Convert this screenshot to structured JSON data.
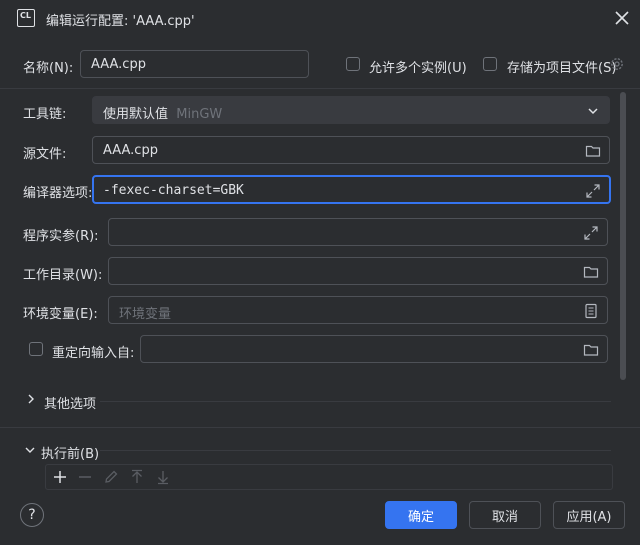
{
  "window": {
    "title": "编辑运行配置: 'AAA.cpp'",
    "app_icon_text": "CL"
  },
  "name": {
    "label": "名称(N):",
    "value": "AAA.cpp"
  },
  "options": {
    "allow_multiple": "允许多个实例(U)",
    "store_as_project": "存储为项目文件(S)"
  },
  "toolchain": {
    "label": "工具链:",
    "value": "使用默认值",
    "hint": "MinGW"
  },
  "source_file": {
    "label": "源文件:",
    "value": "AAA.cpp"
  },
  "compiler_options": {
    "label": "编译器选项:",
    "value": "-fexec-charset=GBK"
  },
  "program_args": {
    "label": "程序实参(R):",
    "value": ""
  },
  "working_dir": {
    "label": "工作目录(W):",
    "value": ""
  },
  "env_vars": {
    "label": "环境变量(E):",
    "placeholder": "环境变量"
  },
  "redirect_input": {
    "label": "重定向输入自:",
    "value": ""
  },
  "other_options": {
    "label": "其他选项"
  },
  "before_launch": {
    "label": "执行前(B)"
  },
  "footer": {
    "help": "?",
    "ok": "确定",
    "cancel": "取消",
    "apply": "应用(A)"
  },
  "colors": {
    "background": "#2b2d30",
    "accent": "#3574f0",
    "border": "#4e5157"
  }
}
